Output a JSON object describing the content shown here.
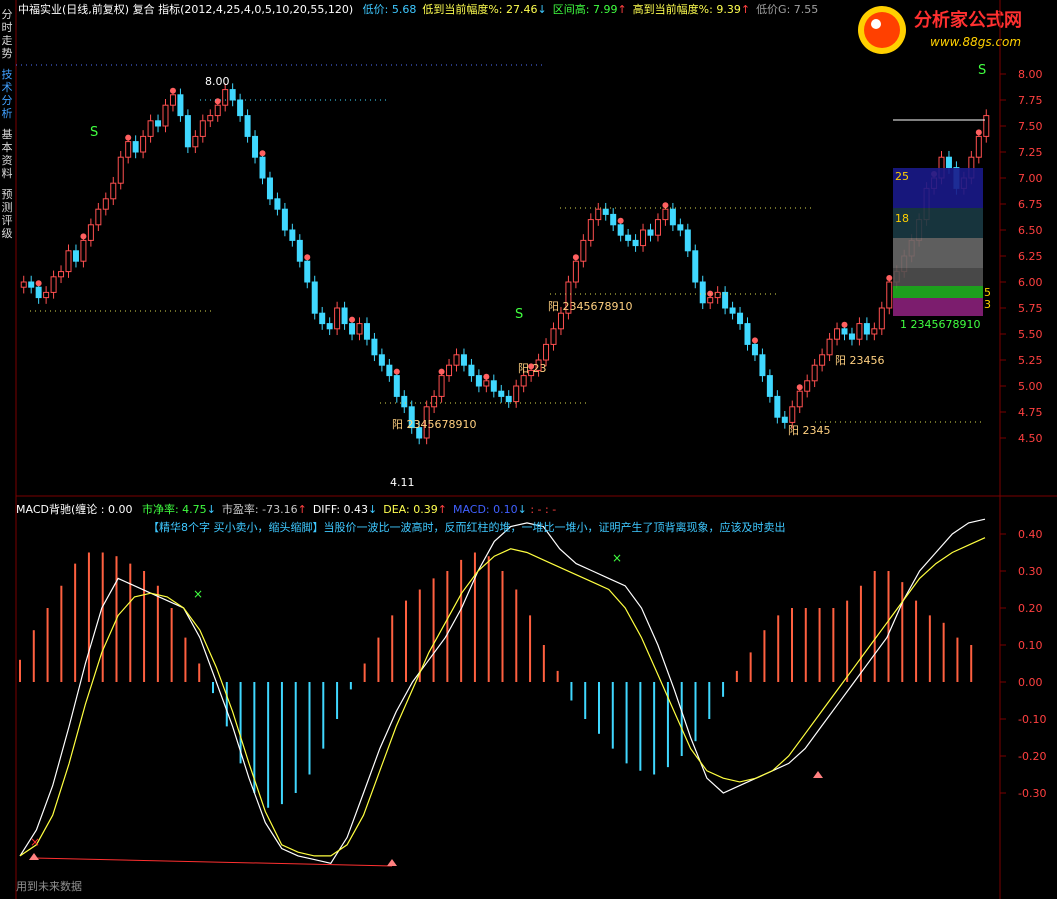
{
  "window": {
    "stock_name": "中福实业",
    "mode": "(日线,前复权)",
    "indicator_label": "复合 指标(2012,4,25,4,0,5,10,20,55,120)",
    "stats": [
      {
        "label": "低价:",
        "value": "5.68",
        "color": "#3ec8ff",
        "arrow": ""
      },
      {
        "label": "低到当前幅度%:",
        "value": "27.46",
        "color": "#ffff50",
        "arrow": "↓"
      },
      {
        "label": "区间高:",
        "value": "7.99",
        "color": "#40ff40",
        "arrow": "↑"
      },
      {
        "label": "高到当前幅度%:",
        "value": "9.39",
        "color": "#ffff50",
        "arrow": "↑"
      },
      {
        "label": "低价G:",
        "value": "7.55",
        "color": "#a0a0a0",
        "arrow": ""
      }
    ]
  },
  "side_tabs": [
    {
      "label": "分时走势",
      "active": false
    },
    {
      "label": "技术分析",
      "active": true
    },
    {
      "label": "基本资料",
      "active": false
    },
    {
      "label": "预测评级",
      "active": false
    }
  ],
  "logo": {
    "title": "分析家公式网",
    "url_text": "www.88gs.com"
  },
  "price_axis": [
    "8.00",
    "7.75",
    "7.50",
    "7.25",
    "7.00",
    "6.75",
    "6.50",
    "6.25",
    "6.00",
    "5.75",
    "5.50",
    "5.25",
    "5.00",
    "4.75",
    "4.50"
  ],
  "macd_axis": [
    "0.40",
    "0.30",
    "0.20",
    "0.10",
    "0.00",
    "-0.10",
    "-0.20",
    "-0.30"
  ],
  "annotations": {
    "high_label": "8.00",
    "low_label": "4.11",
    "yang_sequences": [
      {
        "text": "阳 2345678910"
      },
      {
        "text": "阳 23"
      },
      {
        "text": "阳 2345678910"
      },
      {
        "text": "阳 23456"
      },
      {
        "text": "阳 2345"
      }
    ],
    "s_marks": [
      "S",
      "S",
      "S"
    ],
    "box_numbers": [
      "25",
      "18",
      "5",
      "3"
    ],
    "count_row": "1 2345678910"
  },
  "macd_header": {
    "title": "MACD背驰(缠论 : 0.00",
    "stats": [
      {
        "label": "市净率:",
        "value": "4.75",
        "color": "#40ff40",
        "arrow": "↓"
      },
      {
        "label": "市盈率:",
        "value": "-73.16",
        "color": "#c8c8c8",
        "arrow": "↑"
      },
      {
        "label": "DIFF:",
        "value": "0.43",
        "color": "#ffffff",
        "arrow": "↓"
      },
      {
        "label": "DEA:",
        "value": "0.39",
        "color": "#ffff50",
        "arrow": "↑"
      },
      {
        "label": "MACD:",
        "value": "0.10",
        "color": "#4060ff",
        "arrow": "↓"
      }
    ],
    "trail": ": - : -",
    "tip": "【精华8个字 买小卖小，缩头缩脚】当股价一波比一波高时，反而红柱的堆，一堆比一堆小，证明产生了顶背离现象，应该及时卖出"
  },
  "footer": {
    "text": "用到未来数据"
  },
  "colors": {
    "up": "#ff5050",
    "down": "#40d8ff",
    "diff": "#ffffff",
    "dea": "#ffff40",
    "grid": "#7a0000"
  },
  "chart_data": [
    {
      "type": "candlestick",
      "ylim": [
        4.0,
        8.2
      ],
      "closes": [
        6.0,
        5.95,
        5.85,
        5.9,
        6.05,
        6.1,
        6.3,
        6.2,
        6.4,
        6.55,
        6.7,
        6.8,
        6.95,
        7.2,
        7.35,
        7.25,
        7.4,
        7.55,
        7.5,
        7.7,
        7.8,
        7.6,
        7.3,
        7.4,
        7.55,
        7.6,
        7.7,
        7.85,
        7.75,
        7.6,
        7.4,
        7.2,
        7.0,
        6.8,
        6.7,
        6.5,
        6.4,
        6.2,
        6.0,
        5.7,
        5.6,
        5.55,
        5.75,
        5.6,
        5.5,
        5.6,
        5.45,
        5.3,
        5.2,
        5.1,
        4.9,
        4.8,
        4.6,
        4.5,
        4.8,
        4.9,
        5.1,
        5.2,
        5.3,
        5.2,
        5.1,
        5.0,
        5.05,
        4.95,
        4.9,
        4.85,
        5.0,
        5.1,
        5.15,
        5.25,
        5.4,
        5.55,
        5.7,
        6.0,
        6.2,
        6.4,
        6.6,
        6.7,
        6.65,
        6.55,
        6.45,
        6.4,
        6.35,
        6.5,
        6.45,
        6.6,
        6.7,
        6.55,
        6.5,
        6.3,
        6.0,
        5.8,
        5.85,
        5.9,
        5.75,
        5.7,
        5.6,
        5.4,
        5.3,
        5.1,
        4.9,
        4.7,
        4.65,
        4.8,
        4.95,
        5.05,
        5.2,
        5.3,
        5.45,
        5.55,
        5.5,
        5.45,
        5.6,
        5.5,
        5.55,
        5.75,
        6.0,
        6.1,
        6.25,
        6.4,
        6.6,
        6.9,
        7.0,
        7.2,
        7.1,
        6.9,
        7.0,
        7.2,
        7.4,
        7.6
      ]
    },
    {
      "type": "bar+line",
      "ylim": [
        -0.5,
        0.45
      ],
      "macd": [
        0.06,
        0.14,
        0.2,
        0.26,
        0.32,
        0.35,
        0.35,
        0.34,
        0.32,
        0.3,
        0.26,
        0.2,
        0.12,
        0.05,
        -0.03,
        -0.12,
        -0.22,
        -0.3,
        -0.34,
        -0.33,
        -0.3,
        -0.25,
        -0.18,
        -0.1,
        -0.02,
        0.05,
        0.12,
        0.18,
        0.22,
        0.25,
        0.28,
        0.3,
        0.33,
        0.35,
        0.34,
        0.3,
        0.25,
        0.18,
        0.1,
        0.03,
        -0.05,
        -0.1,
        -0.14,
        -0.18,
        -0.22,
        -0.24,
        -0.25,
        -0.23,
        -0.2,
        -0.16,
        -0.1,
        -0.04,
        0.03,
        0.08,
        0.14,
        0.18,
        0.2,
        0.2,
        0.2,
        0.2,
        0.22,
        0.26,
        0.3,
        0.3,
        0.27,
        0.22,
        0.18,
        0.16,
        0.12,
        0.1
      ],
      "diff": [
        -0.47,
        -0.4,
        -0.28,
        -0.12,
        0.05,
        0.2,
        0.28,
        0.26,
        0.24,
        0.22,
        0.2,
        0.12,
        0.0,
        -0.12,
        -0.26,
        -0.38,
        -0.45,
        -0.47,
        -0.48,
        -0.49,
        -0.42,
        -0.3,
        -0.18,
        -0.08,
        0.0,
        0.06,
        0.12,
        0.2,
        0.3,
        0.38,
        0.42,
        0.43,
        0.42,
        0.36,
        0.32,
        0.3,
        0.28,
        0.26,
        0.2,
        0.1,
        -0.02,
        -0.15,
        -0.26,
        -0.3,
        -0.28,
        -0.26,
        -0.24,
        -0.22,
        -0.18,
        -0.12,
        -0.06,
        0.0,
        0.06,
        0.12,
        0.22,
        0.3,
        0.35,
        0.4,
        0.43,
        0.44
      ],
      "dea": [
        -0.47,
        -0.44,
        -0.36,
        -0.22,
        -0.06,
        0.08,
        0.18,
        0.23,
        0.24,
        0.23,
        0.2,
        0.14,
        0.04,
        -0.08,
        -0.22,
        -0.35,
        -0.44,
        -0.46,
        -0.47,
        -0.47,
        -0.44,
        -0.36,
        -0.24,
        -0.12,
        -0.02,
        0.08,
        0.16,
        0.24,
        0.3,
        0.34,
        0.36,
        0.35,
        0.33,
        0.31,
        0.29,
        0.27,
        0.25,
        0.2,
        0.12,
        0.02,
        -0.08,
        -0.18,
        -0.24,
        -0.26,
        -0.27,
        -0.26,
        -0.24,
        -0.2,
        -0.14,
        -0.08,
        -0.02,
        0.04,
        0.1,
        0.16,
        0.22,
        0.28,
        0.32,
        0.35,
        0.37,
        0.39
      ]
    }
  ]
}
